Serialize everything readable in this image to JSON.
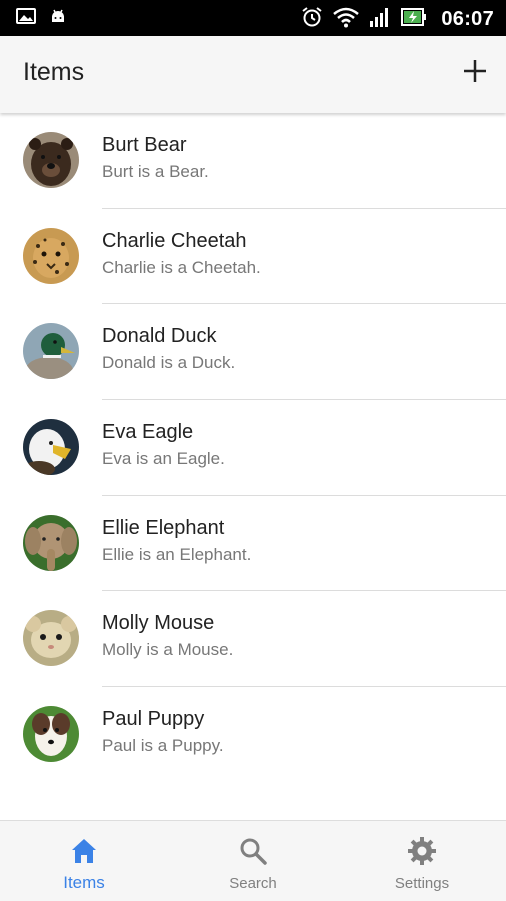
{
  "status_bar": {
    "time": "06:07",
    "icons": [
      "image-icon",
      "android-icon",
      "alarm-icon",
      "wifi-icon",
      "signal-icon",
      "battery-charging-icon"
    ]
  },
  "app_bar": {
    "title": "Items",
    "add_icon": "plus-icon"
  },
  "items": [
    {
      "name": "Burt Bear",
      "description": "Burt is a Bear.",
      "avatar_color": "#3b2a1e"
    },
    {
      "name": "Charlie Cheetah",
      "description": "Charlie is a Cheetah.",
      "avatar_color": "#b8843c"
    },
    {
      "name": "Donald Duck",
      "description": "Donald is a Duck.",
      "avatar_color": "#2f6b4a"
    },
    {
      "name": "Eva Eagle",
      "description": "Eva is an Eagle.",
      "avatar_color": "#d8d8d8"
    },
    {
      "name": "Ellie Elephant",
      "description": "Ellie is an Elephant.",
      "avatar_color": "#a58862"
    },
    {
      "name": "Molly Mouse",
      "description": "Molly is a Mouse.",
      "avatar_color": "#cbbf9a"
    },
    {
      "name": "Paul Puppy",
      "description": "Paul is a Puppy.",
      "avatar_color": "#5a3b2a"
    }
  ],
  "bottom_nav": {
    "tabs": [
      {
        "label": "Items",
        "icon": "home-icon",
        "active": true
      },
      {
        "label": "Search",
        "icon": "search-icon",
        "active": false
      },
      {
        "label": "Settings",
        "icon": "gear-icon",
        "active": false
      }
    ],
    "active_color": "#3b82e6",
    "inactive_color": "#808080"
  }
}
